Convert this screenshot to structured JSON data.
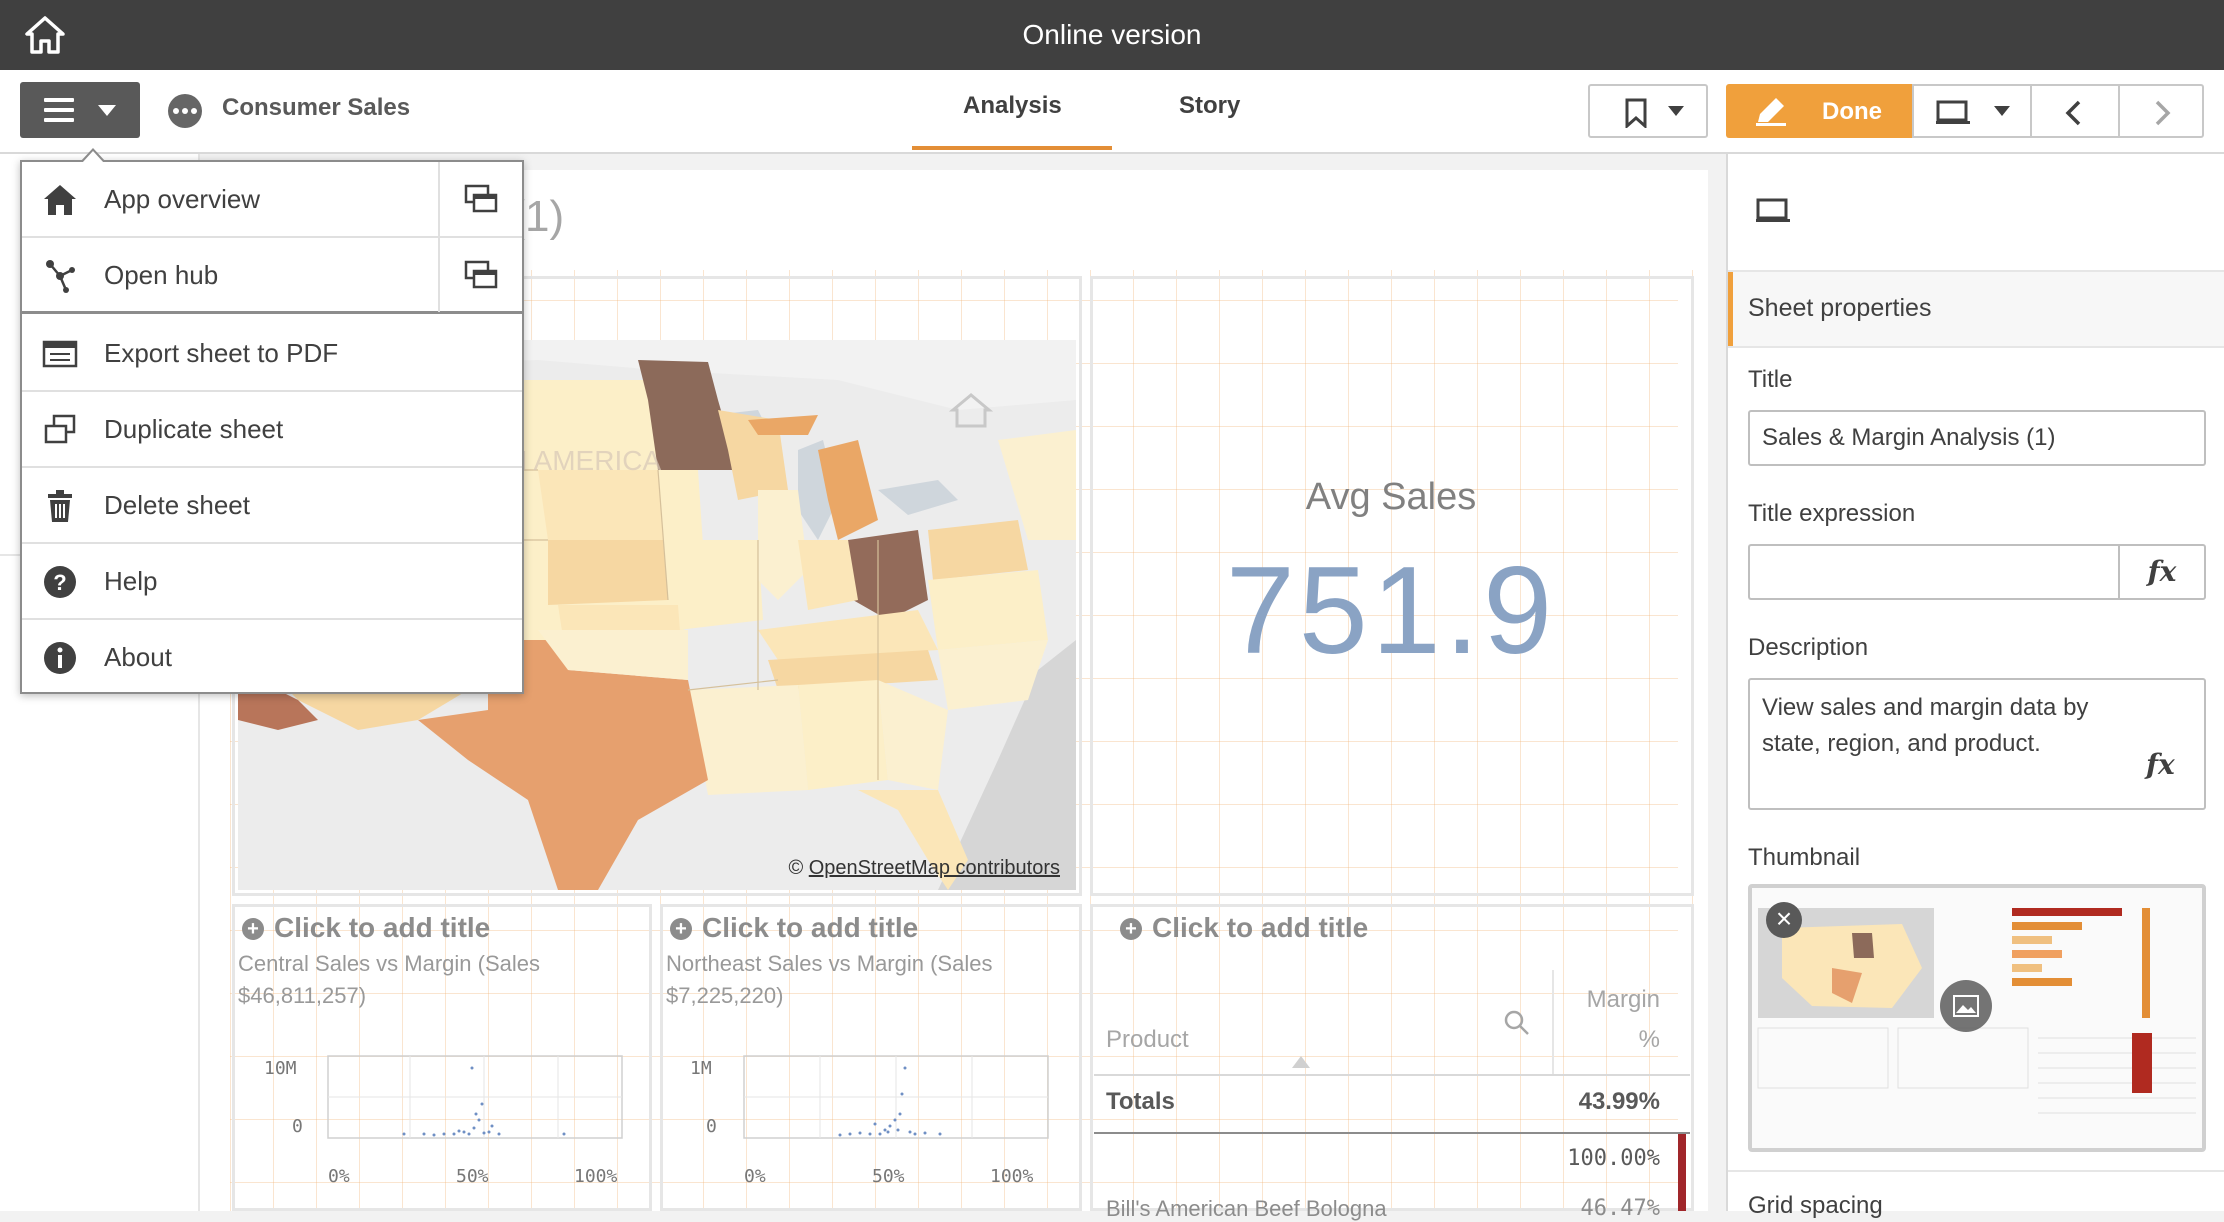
{
  "window": {
    "title": "Online version"
  },
  "toolbar": {
    "app_name": "Consumer Sales",
    "tabs": [
      {
        "label": "Analysis",
        "active": true
      },
      {
        "label": "Story",
        "active": false
      }
    ],
    "done_label": "Done",
    "accent_color": "#f0a03c"
  },
  "menu": {
    "items": [
      {
        "label": "App overview",
        "icon": "home-icon"
      },
      {
        "label": "Open hub",
        "icon": "hub-icon"
      },
      {
        "label": "Export sheet to PDF",
        "icon": "pdf-icon"
      },
      {
        "label": "Duplicate sheet",
        "icon": "duplicate-icon"
      },
      {
        "label": "Delete sheet",
        "icon": "trash-icon"
      },
      {
        "label": "Help",
        "icon": "help-icon"
      },
      {
        "label": "About",
        "icon": "info-icon"
      }
    ]
  },
  "sheet": {
    "title_visible": "n Analysis (1)",
    "map_label": "TH AMERICA",
    "map_credit_prefix": "© ",
    "map_credit_link": "OpenStreetMap contributors",
    "kpi": {
      "label": "Avg Sales",
      "value": "751.9"
    },
    "charts": [
      {
        "add_title": "Click to add title",
        "subtitle_line1": "Central Sales vs Margin (Sales",
        "subtitle_line2": "$46,811,257)",
        "y_ticks": [
          "10M",
          "0"
        ],
        "x_ticks": [
          "0%",
          "50%",
          "100%"
        ]
      },
      {
        "add_title": "Click to add title",
        "subtitle_line1": "Northeast Sales vs Margin (Sales",
        "subtitle_line2": "$7,225,220)",
        "y_ticks": [
          "1M",
          "0"
        ],
        "x_ticks": [
          "0%",
          "50%",
          "100%"
        ]
      }
    ],
    "table": {
      "add_title": "Click to add title",
      "col_product": "Product",
      "col_margin_line1": "Margin",
      "col_margin_line2": "%",
      "totals_label": "Totals",
      "totals_value": "43.99%",
      "row1_value": "100.00%",
      "row2_label": "Bill's American Beef Bologna",
      "row2_value": "46.47%"
    }
  },
  "props": {
    "section": "Sheet properties",
    "title_label": "Title",
    "title_value": "Sales & Margin Analysis (1)",
    "title_expr_label": "Title expression",
    "fx": "fx",
    "description_label": "Description",
    "description_value": "View sales and margin data by state, region, and product.",
    "thumbnail_label": "Thumbnail",
    "grid_spacing_label": "Grid spacing"
  }
}
